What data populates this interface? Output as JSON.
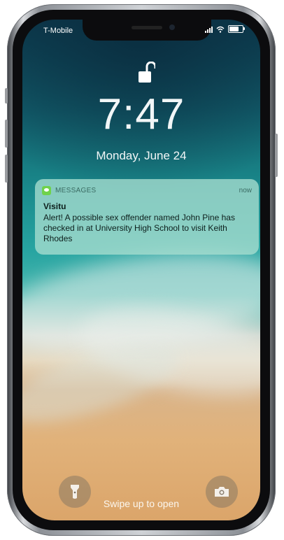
{
  "status_bar": {
    "carrier": "T-Mobile"
  },
  "lock_screen": {
    "time": "7:47",
    "date": "Monday, June 24"
  },
  "notification": {
    "app": "MESSAGES",
    "time": "now",
    "sender": "Visitu",
    "message": "Alert! A possible sex offender named John Pine has checked in at University High School to visit Keith Rhodes"
  },
  "quick_actions": {
    "left_icon": "flashlight-icon",
    "right_icon": "camera-icon"
  },
  "footer": {
    "hint": "Swipe up to open"
  }
}
